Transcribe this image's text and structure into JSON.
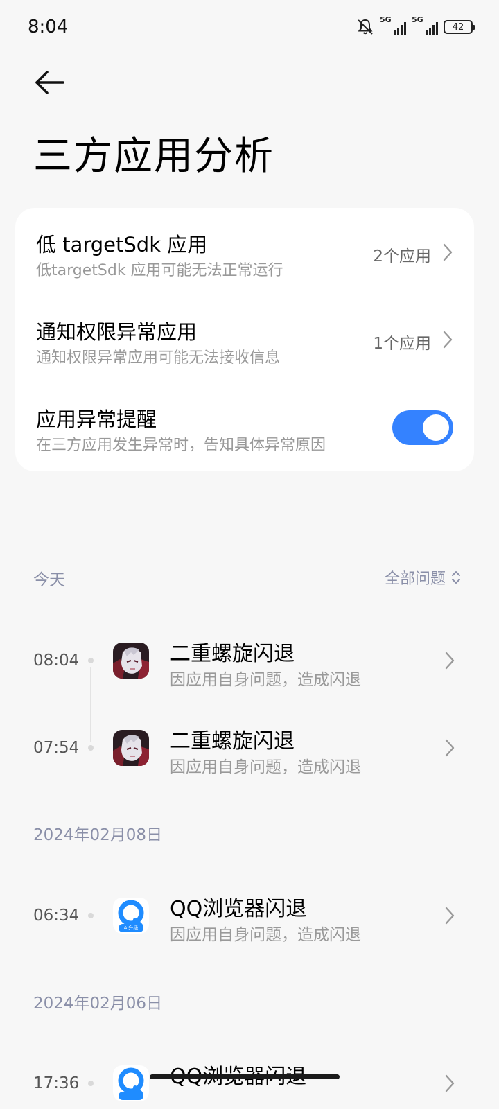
{
  "status_bar": {
    "time": "8:04",
    "signal1_label": "5G",
    "signal2_label": "5G",
    "battery": "42",
    "icons": [
      "bell-muted-icon",
      "signal-icon",
      "signal-icon",
      "battery-icon"
    ]
  },
  "header": {
    "back_icon": "arrow-left-icon",
    "title": "三方应用分析"
  },
  "settings": [
    {
      "title": "低 targetSdk 应用",
      "subtitle": "低targetSdk 应用可能无法正常运行",
      "value": "2个应用"
    },
    {
      "title": "通知权限异常应用",
      "subtitle": "通知权限异常应用可能无法接收信息",
      "value": "1个应用"
    },
    {
      "title": "应用异常提醒",
      "subtitle": "在三方应用发生异常时，告知具体异常原因",
      "toggle_on": true
    }
  ],
  "log": {
    "filter_label": "全部问题",
    "sections": [
      {
        "date": "今天",
        "items": [
          {
            "time": "08:04",
            "title": "二重螺旋闪退",
            "subtitle": "因应用自身问题，造成闪退",
            "icon": "game-avatar-icon"
          },
          {
            "time": "07:54",
            "title": "二重螺旋闪退",
            "subtitle": "因应用自身问题，造成闪退",
            "icon": "game-avatar-icon"
          }
        ]
      },
      {
        "date": "2024年02月08日",
        "items": [
          {
            "time": "06:34",
            "title": "QQ浏览器闪退",
            "subtitle": "因应用自身问题，造成闪退",
            "icon": "qq-browser-icon",
            "badge": "AI升级"
          }
        ]
      },
      {
        "date": "2024年02月06日",
        "items": [
          {
            "time": "17:36",
            "title": "QQ浏览器闪退",
            "icon": "qq-browser-icon"
          }
        ]
      }
    ]
  },
  "colors": {
    "background": "#f7f7f7",
    "card": "#ffffff",
    "accent": "#3482ff",
    "section_label": "#8a8fa8",
    "secondary_text": "#999999"
  }
}
